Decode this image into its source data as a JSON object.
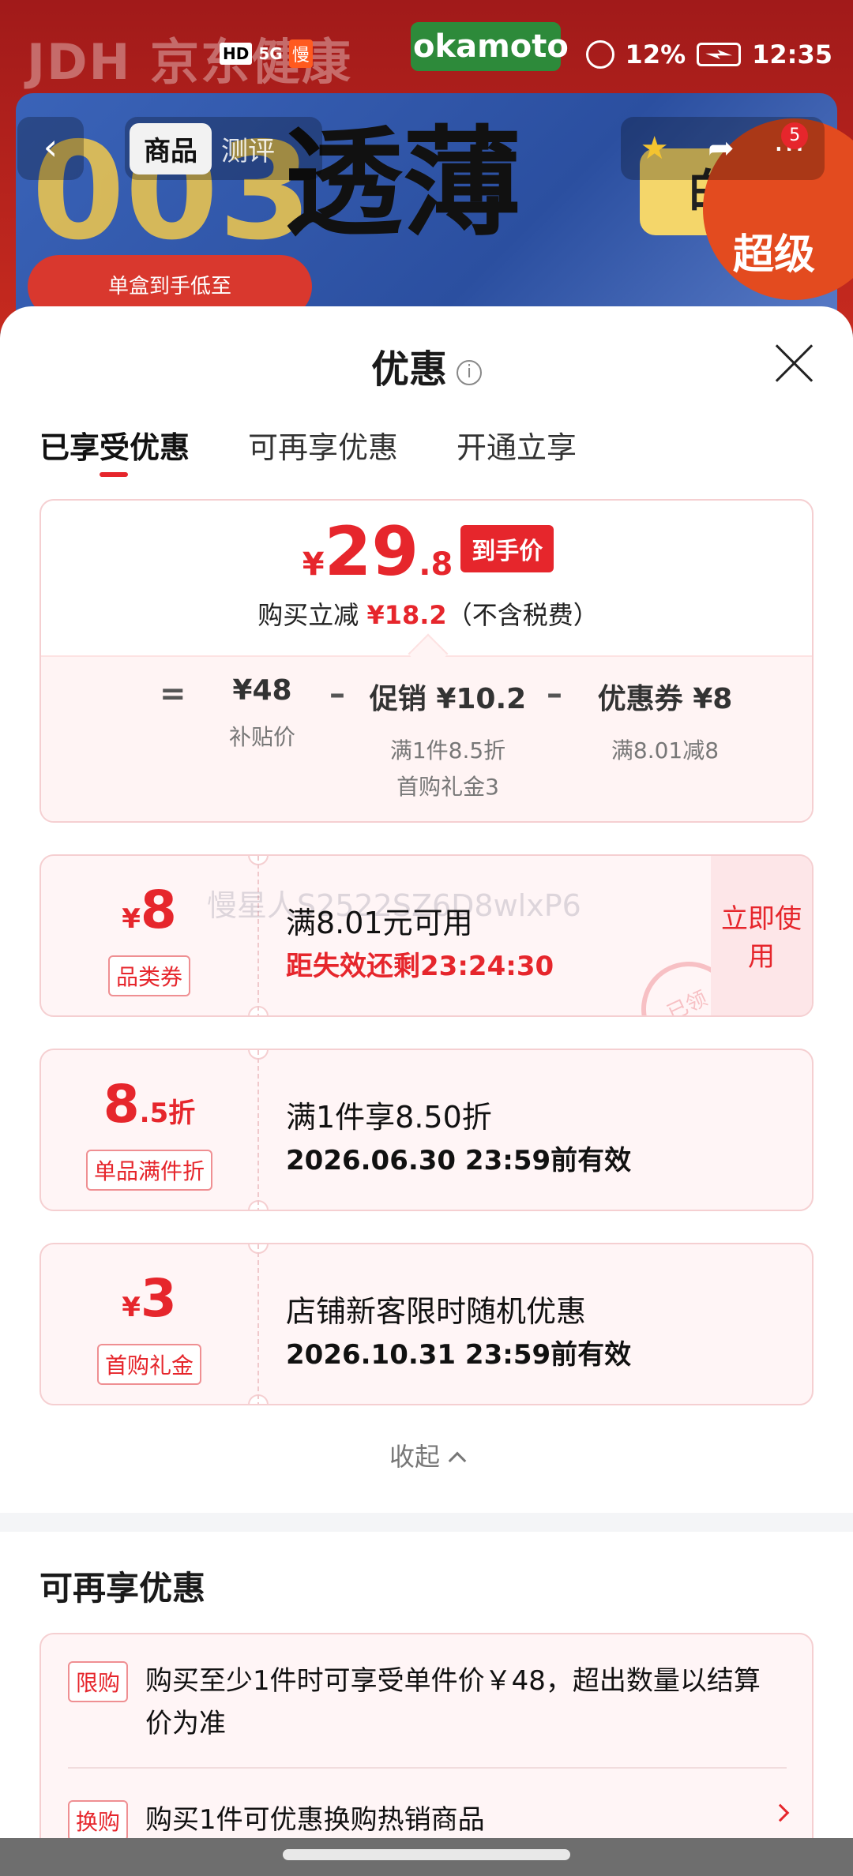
{
  "background": {
    "brand": "JDH 京东健康",
    "store_logo": "okamoto",
    "banner_number": "003",
    "banner_headline": "透薄",
    "banner_gold": "白金",
    "banner_pill": "单盒到手低至",
    "banner_badge": "超级"
  },
  "status_bar": {
    "network": "5G",
    "battery": "12%",
    "time": "12:35"
  },
  "nav": {
    "tab_product": "商品",
    "tab_review": "测评",
    "cart_badge": "5"
  },
  "sheet": {
    "title": "优惠",
    "tabs": [
      "已享受优惠",
      "可再享优惠",
      "开通立享"
    ],
    "price": {
      "currency": "¥",
      "integer": "29",
      "decimal": ".8",
      "tag": "到手价",
      "sub_prefix": "购买立减",
      "sub_amount": "¥18.2",
      "sub_suffix": "（不含税费）"
    },
    "calc": {
      "eq": "=",
      "minus": "–",
      "base_value": "¥48",
      "base_label": "补贴价",
      "promo_value": "促销 ¥10.2",
      "promo_label_1": "满1件8.5折",
      "promo_label_2": "首购礼金3",
      "coupon_value": "优惠券 ¥8",
      "coupon_label": "满8.01减8"
    },
    "coupons": [
      {
        "currency": "¥",
        "amount": "8",
        "type": "品类券",
        "title": "满8.01元可用",
        "desc": "距失效还剩23:24:30",
        "action": "立即使用",
        "stamp": "已领",
        "watermark": "慢星人S2522SZ6D8wlxP6"
      },
      {
        "amount_big": "8",
        "amount_small": ".5折",
        "type": "单品满件折",
        "title": "满1件享8.50折",
        "desc": "2026.06.30 23:59前有效"
      },
      {
        "currency": "¥",
        "amount": "3",
        "type": "首购礼金",
        "title": "店铺新客限时随机优惠",
        "desc": "2026.10.31 23:59前有效"
      }
    ],
    "collapse_label": "收起",
    "section2_title": "可再享优惠",
    "more": [
      {
        "tag": "限购",
        "text": "购买至少1件时可享受单件价￥48，超出数量以结算价为准"
      },
      {
        "tag": "换购",
        "text": "购买1件可优惠换购热销商品"
      }
    ]
  },
  "colors": {
    "accent": "#e6262c",
    "border": "#f5cfd1"
  }
}
